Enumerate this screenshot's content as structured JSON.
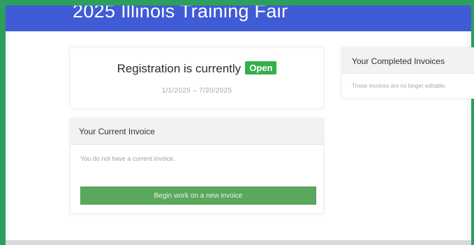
{
  "app": {
    "title": "2025 Illinois Training Fair"
  },
  "registration": {
    "status_text": "Registration is currently",
    "status_badge": "Open",
    "dates_text": "1/1/2025 – 7/20/2025"
  },
  "current_invoice": {
    "header": "Your Current Invoice",
    "empty_text": "You do not have a current invoice.",
    "begin_button": "Begin work on a new invoice"
  },
  "completed_invoices": {
    "header": "Your Completed Invoices",
    "empty_text": "These invoices are no longer editable."
  },
  "colors": {
    "banner": "#3f5bd6",
    "frame": "#2e9e5f",
    "open_badge": "#33b04a",
    "button": "#5aa85c"
  }
}
